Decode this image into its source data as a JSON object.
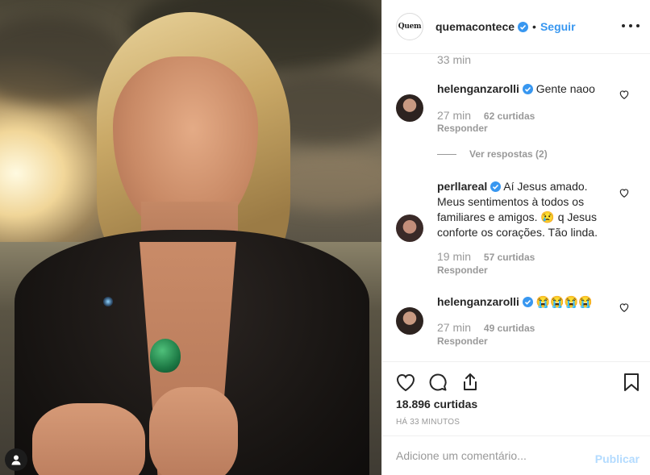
{
  "photo": {
    "alt": ""
  },
  "header": {
    "username": "quemacontece",
    "avatar_text": "Quem",
    "separator": "•",
    "follow_label": "Seguir"
  },
  "comments": {
    "top_time": "33 min",
    "items": [
      {
        "username": "helenganzarolli",
        "text": "Gente naoo",
        "time": "27 min",
        "likes": "62 curtidas",
        "reply": "Responder"
      },
      {
        "username": "perllareal",
        "text": "Aí Jesus amado. Meus sentimentos à todos os familiares e amigos. 😢 q Jesus conforte os corações. Tão linda.",
        "time": "19 min",
        "likes": "57 curtidas",
        "reply": "Responder"
      },
      {
        "username": "helenganzarolli",
        "text": "😭😭😭😭",
        "time": "27 min",
        "likes": "49 curtidas",
        "reply": "Responder"
      }
    ],
    "view_replies": "Ver respostas (2)"
  },
  "actions": {
    "like_count": "18.896 curtidas",
    "posted_ago": "HÁ 33 MINUTOS"
  },
  "add_comment": {
    "placeholder": "Adicione um comentário...",
    "publish_label": "Publicar"
  },
  "colors": {
    "link_blue": "#3897f0",
    "muted": "#999999",
    "publish_disabled": "#b3dbff",
    "text": "#262626"
  }
}
